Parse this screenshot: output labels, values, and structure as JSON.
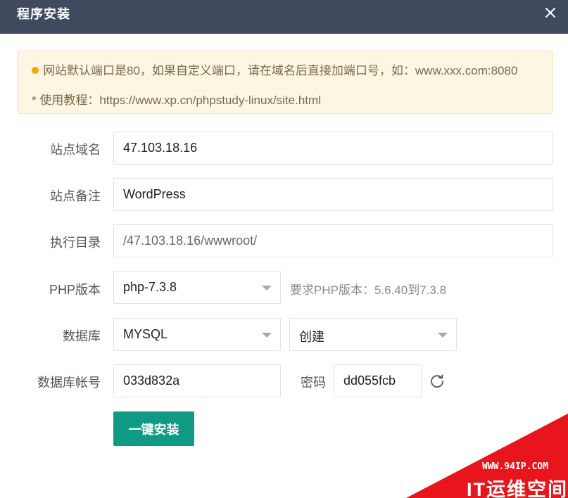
{
  "dialog": {
    "title": "程序安装"
  },
  "notice": {
    "line1": "网站默认端口是80，如果自定义端口，请在域名后直接加端口号，如：www.xxx.com:8080",
    "line2": "* 使用教程：https://www.xp.cn/phpstudy-linux/site.html"
  },
  "form": {
    "domain": {
      "label": "站点域名",
      "value": "47.103.18.16"
    },
    "remark": {
      "label": "站点备注",
      "value": "WordPress"
    },
    "directory": {
      "label": "执行目录",
      "value": "/47.103.18.16/wwwroot/"
    },
    "php": {
      "label": "PHP版本",
      "selected": "php-7.3.8",
      "hint": "要求PHP版本：5.6.40到7.3.8"
    },
    "database": {
      "label": "数据库",
      "type_selected": "MYSQL",
      "action_selected": "创建"
    },
    "db_account": {
      "label": "数据库帐号",
      "value": "033d832a"
    },
    "password": {
      "label": "密码",
      "value": "dd055fcb"
    },
    "submit_label": "一键安装"
  },
  "watermark": {
    "url": "WWW.94IP.COM",
    "name": "IT运维空间"
  },
  "colors": {
    "titlebar": "#3f4a5e",
    "accent": "#0e9a84",
    "notice_bg": "#fdf6e3",
    "notice_dot": "#f5a900",
    "watermark": "#e8151c"
  },
  "icons": {
    "close": "close-icon",
    "refresh": "refresh-icon",
    "dropdown": "chevron-down-icon"
  }
}
